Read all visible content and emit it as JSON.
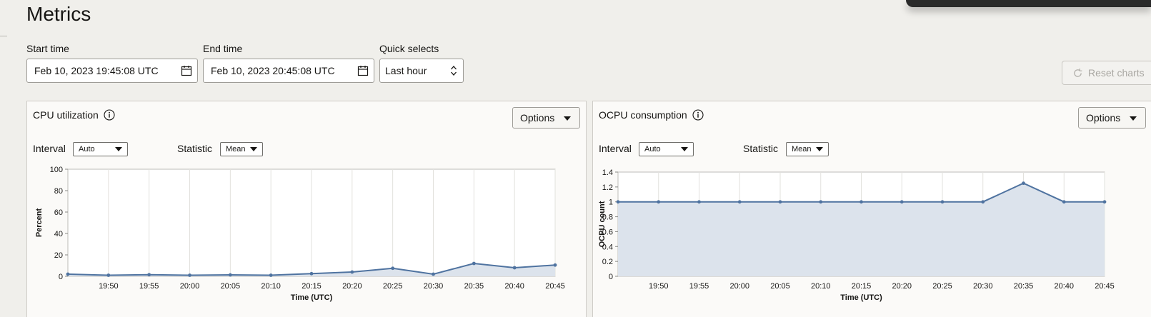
{
  "page": {
    "title": "Metrics"
  },
  "filters": {
    "start_label": "Start time",
    "start_value": "Feb 10, 2023 19:45:08 UTC",
    "end_label": "End time",
    "end_value": "Feb 10, 2023 20:45:08 UTC",
    "quick_label": "Quick selects",
    "quick_value": "Last hour",
    "reset_label": "Reset charts"
  },
  "panels": [
    {
      "title": "CPU utilization",
      "options_label": "Options",
      "interval_label": "Interval",
      "interval_value": "Auto",
      "statistic_label": "Statistic",
      "statistic_value": "Mean",
      "ylabel": "Percent",
      "xlabel": "Time (UTC)"
    },
    {
      "title": "OCPU consumption",
      "options_label": "Options",
      "interval_label": "Interval",
      "interval_value": "Auto",
      "statistic_label": "Statistic",
      "statistic_value": "Mean",
      "ylabel": "OCPU count",
      "xlabel": "Time (UTC)"
    }
  ],
  "chart_data": [
    {
      "type": "area",
      "title": "CPU utilization",
      "xlabel": "Time (UTC)",
      "ylabel": "Percent",
      "x": [
        "19:45",
        "19:50",
        "19:55",
        "20:00",
        "20:05",
        "20:10",
        "20:15",
        "20:20",
        "20:25",
        "20:30",
        "20:35",
        "20:40",
        "20:45"
      ],
      "x_tick_labels": [
        "19:50",
        "19:55",
        "20:00",
        "20:05",
        "20:10",
        "20:15",
        "20:20",
        "20:25",
        "20:30",
        "20:35",
        "20:40",
        "20:45"
      ],
      "y_ticks": [
        "0",
        "20",
        "40",
        "60",
        "80",
        "100"
      ],
      "values": [
        2,
        1,
        1.5,
        1,
        1.3,
        1,
        2.5,
        4,
        7.5,
        2,
        12,
        8,
        10.5
      ],
      "ylim": [
        0,
        100
      ],
      "grid": true,
      "color": "#4f73a0",
      "fill": "#dce3ec"
    },
    {
      "type": "area",
      "title": "OCPU consumption",
      "xlabel": "Time (UTC)",
      "ylabel": "OCPU count",
      "x": [
        "19:45",
        "19:50",
        "19:55",
        "20:00",
        "20:05",
        "20:10",
        "20:15",
        "20:20",
        "20:25",
        "20:30",
        "20:35",
        "20:40",
        "20:45"
      ],
      "x_tick_labels": [
        "19:50",
        "19:55",
        "20:00",
        "20:05",
        "20:10",
        "20:15",
        "20:20",
        "20:25",
        "20:30",
        "20:35",
        "20:40",
        "20:45"
      ],
      "y_ticks": [
        "0",
        "0.2",
        "0.4",
        "0.6",
        "0.8",
        "1",
        "1.2",
        "1.4"
      ],
      "values": [
        1,
        1,
        1,
        1,
        1,
        1,
        1,
        1,
        1,
        1,
        1.25,
        1,
        1
      ],
      "ylim": [
        0,
        1.4
      ],
      "grid": true,
      "color": "#4f73a0",
      "fill": "#dce3ec"
    }
  ]
}
